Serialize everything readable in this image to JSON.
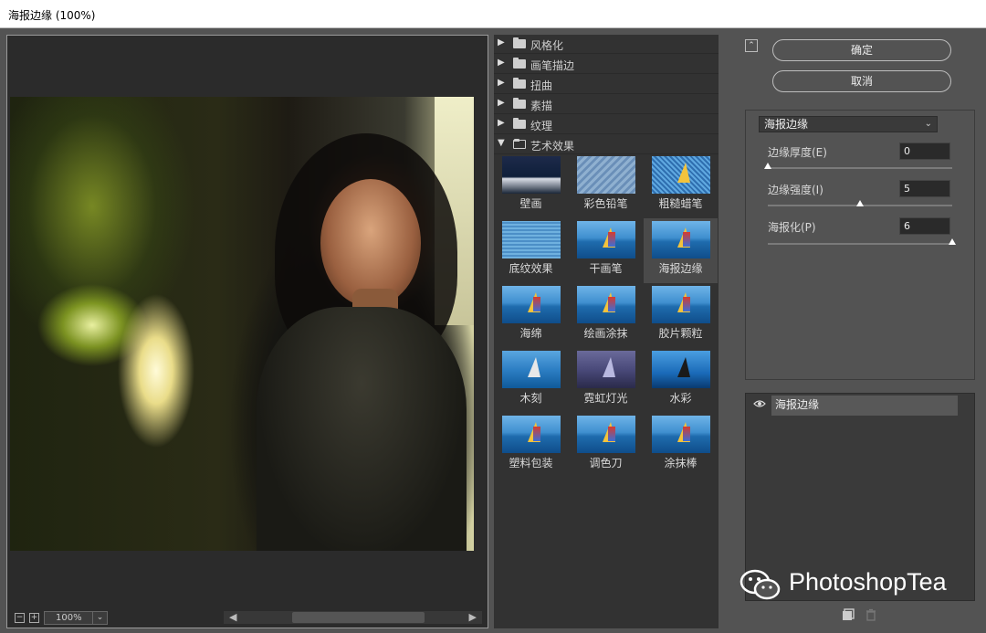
{
  "window": {
    "title": "海报边缘 (100%)"
  },
  "preview": {
    "zoom": "100%",
    "zoom_out": "−",
    "zoom_in": "+"
  },
  "gallery": {
    "categories": [
      {
        "label": "风格化",
        "expanded": false
      },
      {
        "label": "画笔描边",
        "expanded": false
      },
      {
        "label": "扭曲",
        "expanded": false
      },
      {
        "label": "素描",
        "expanded": false
      },
      {
        "label": "纹理",
        "expanded": false
      },
      {
        "label": "艺术效果",
        "expanded": true
      }
    ],
    "filters": [
      "壁画",
      "彩色铅笔",
      "粗糙蜡笔",
      "底纹效果",
      "干画笔",
      "海报边缘",
      "海绵",
      "绘画涂抹",
      "胶片颗粒",
      "木刻",
      "霓虹灯光",
      "水彩",
      "塑料包装",
      "调色刀",
      "涂抹棒"
    ],
    "selected": "海报边缘"
  },
  "actions": {
    "ok": "确定",
    "cancel": "取消"
  },
  "settings": {
    "filter_select": "海报边缘",
    "params": [
      {
        "label": "边缘厚度(E)",
        "value": "0",
        "fraction": 0.0
      },
      {
        "label": "边缘强度(I)",
        "value": "5",
        "fraction": 0.5
      },
      {
        "label": "海报化(P)",
        "value": "6",
        "fraction": 1.0
      }
    ]
  },
  "layers": {
    "items": [
      {
        "name": "海报边缘",
        "visible": true
      }
    ]
  },
  "watermark": {
    "text": "PhotoshopTea"
  }
}
